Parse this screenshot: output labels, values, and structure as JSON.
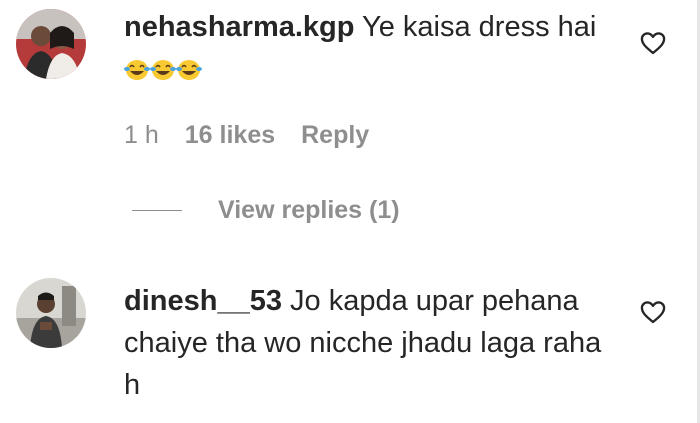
{
  "comments": [
    {
      "username": "nehasharma.kgp",
      "text": "Ye kaisa dress hai",
      "emojis": [
        "face-with-tears-of-joy",
        "face-with-tears-of-joy",
        "face-with-tears-of-joy"
      ],
      "time": "1 h",
      "likes": "16 likes",
      "reply_label": "Reply",
      "view_replies": "View replies (1)"
    },
    {
      "username": "dinesh__53",
      "text": "Jo kapda upar pehana chaiye tha wo nicche jhadu laga raha h"
    }
  ],
  "colors": {
    "text": "#262626",
    "secondary": "#8e8e8e",
    "emoji_face": "#f8c930",
    "emoji_tears": "#4aa3df"
  }
}
